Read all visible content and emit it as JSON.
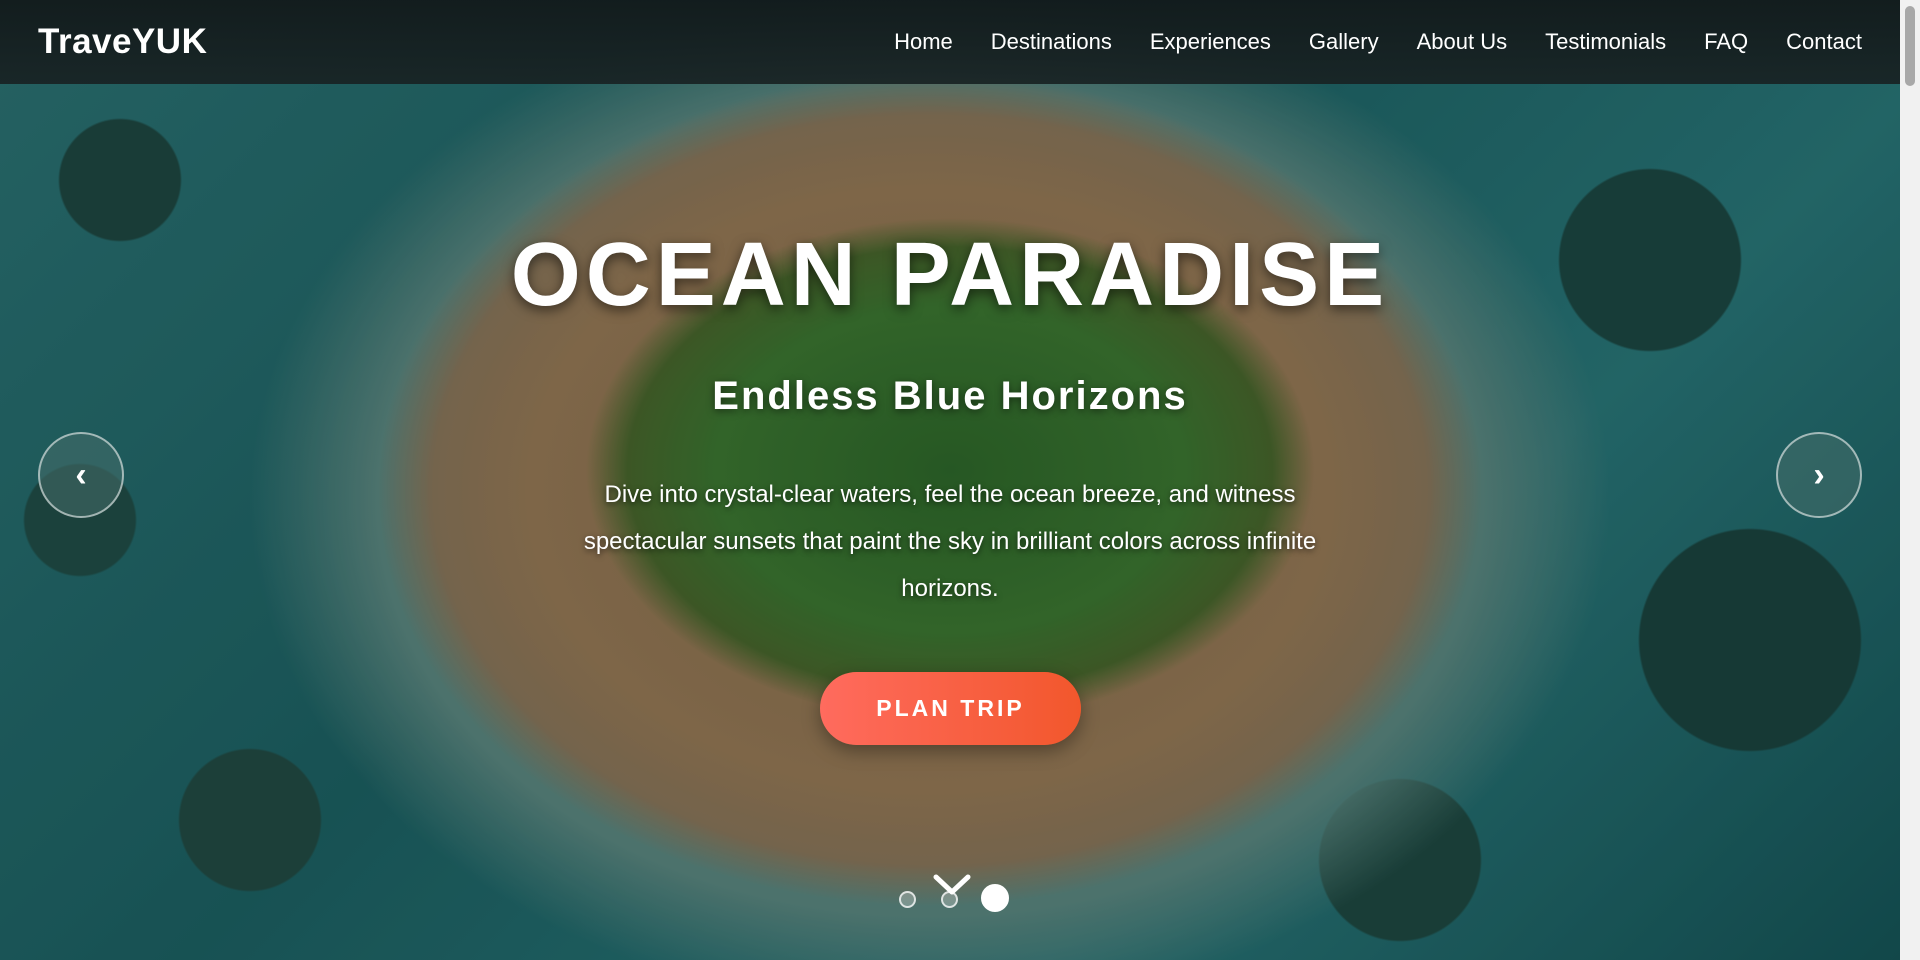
{
  "brand": {
    "logo": "TraveYUK"
  },
  "nav": {
    "items": [
      {
        "label": "Home"
      },
      {
        "label": "Destinations"
      },
      {
        "label": "Experiences"
      },
      {
        "label": "Gallery"
      },
      {
        "label": "About Us"
      },
      {
        "label": "Testimonials"
      },
      {
        "label": "FAQ"
      },
      {
        "label": "Contact"
      }
    ]
  },
  "hero": {
    "title": "OCEAN PARADISE",
    "subtitle": "Endless Blue Horizons",
    "description": "Dive into crystal-clear waters, feel the ocean breeze, and witness spectacular sunsets that paint the sky in brilliant colors across infinite horizons.",
    "cta_label": "PLAN TRIP",
    "prev_arrow": "‹",
    "next_arrow": "›",
    "slides_total": 3,
    "active_slide": 3
  },
  "colors": {
    "cta_start": "#ff6b5e",
    "cta_end": "#f2572c",
    "nav_bg": "#182223",
    "text": "#ffffff"
  },
  "icons": {
    "prev": "chevron-left-icon",
    "next": "chevron-right-icon",
    "scroll": "chevron-down-icon"
  }
}
